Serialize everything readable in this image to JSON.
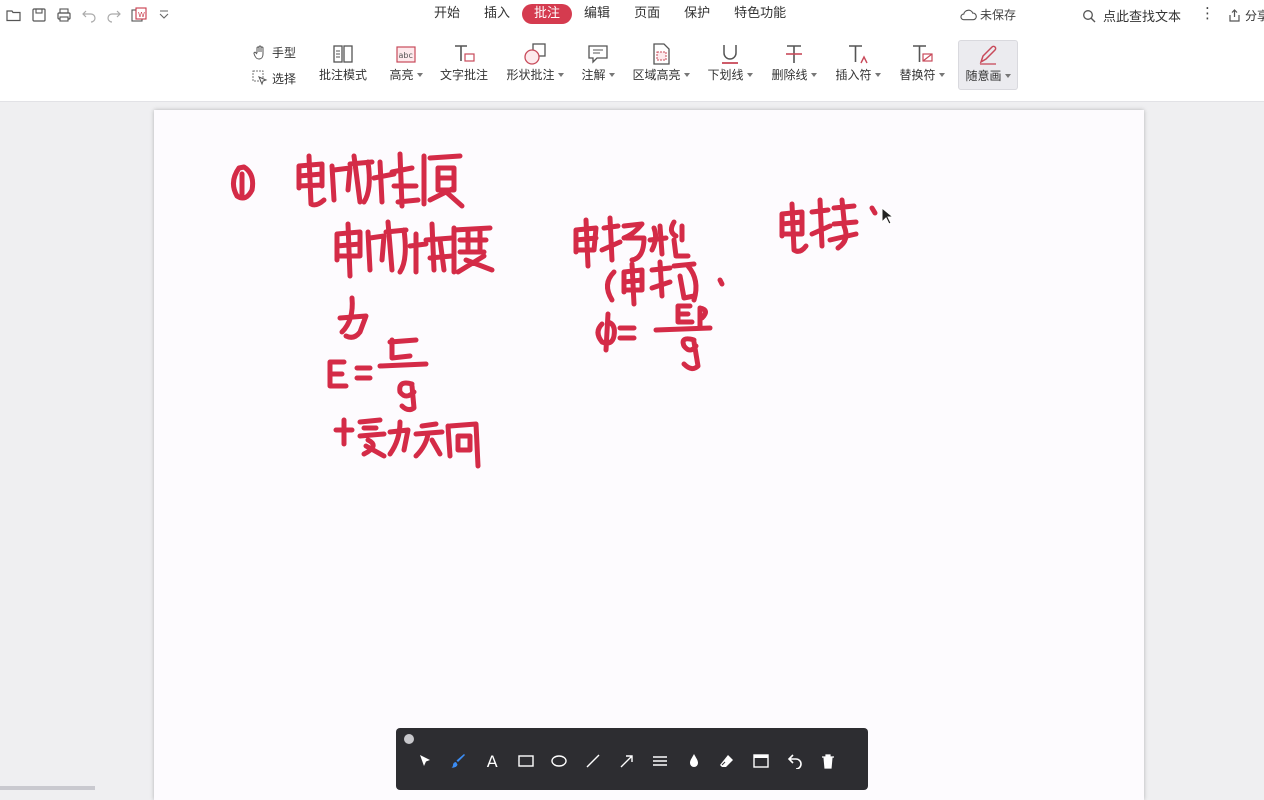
{
  "menus": [
    {
      "label": "开始"
    },
    {
      "label": "插入"
    },
    {
      "label": "批注"
    },
    {
      "label": "编辑"
    },
    {
      "label": "页面"
    },
    {
      "label": "保护"
    },
    {
      "label": "特色功能"
    }
  ],
  "active_menu": "批注",
  "status": {
    "unsaved": "未保存"
  },
  "search": {
    "label": "点此查找文本"
  },
  "share": {
    "label": "分享"
  },
  "small_tools": [
    {
      "label": "手型"
    },
    {
      "label": "选择"
    }
  ],
  "tools": [
    {
      "label": "批注模式",
      "caret": false
    },
    {
      "label": "高亮",
      "caret": true
    },
    {
      "label": "文字批注",
      "caret": false
    },
    {
      "label": "形状批注",
      "caret": true
    },
    {
      "label": "注解",
      "caret": true
    },
    {
      "label": "区域高亮",
      "caret": true
    },
    {
      "label": "下划线",
      "caret": true
    },
    {
      "label": "删除线",
      "caret": true
    },
    {
      "label": "插入符",
      "caret": true
    },
    {
      "label": "替换符",
      "caret": true
    },
    {
      "label": "随意画",
      "caret": true,
      "selected": true
    }
  ],
  "colors": {
    "accent": "#d53b4f",
    "ink": "#d42b47",
    "drawing_toolbar_bg": "#2d2d31",
    "drawing_brush": "#3b8df5"
  },
  "drawing_toolbar": {
    "text_tool": "A",
    "icons": [
      "pointer-icon",
      "brush-icon",
      "text-icon",
      "rectangle-icon",
      "ellipse-icon",
      "line-icon",
      "arrow-icon",
      "line-weight-icon",
      "color-drop-icon",
      "eraser-icon",
      "screen-icon",
      "undo-icon",
      "trash-icon"
    ]
  }
}
